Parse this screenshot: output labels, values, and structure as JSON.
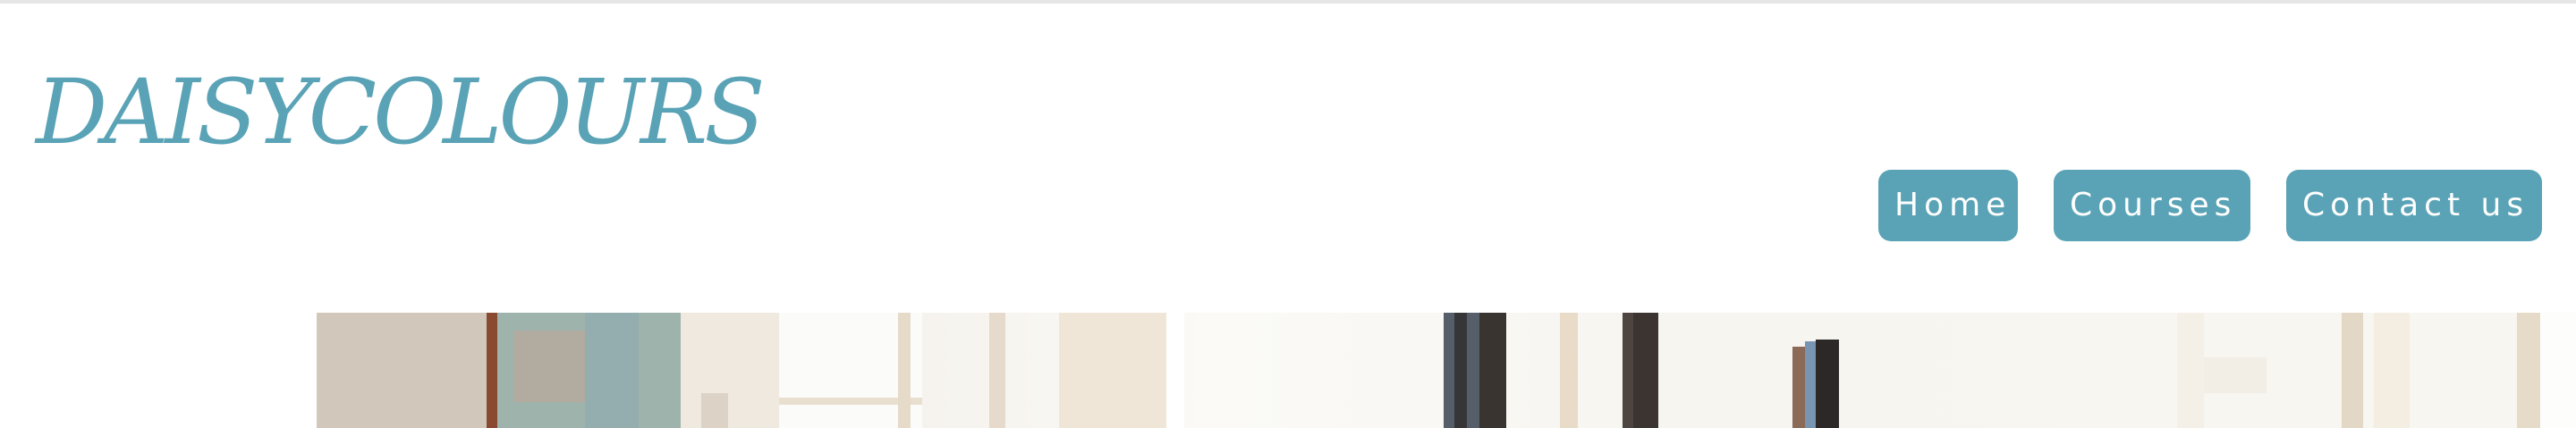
{
  "header": {
    "logo_text": "DAISYCOLOURS"
  },
  "nav": {
    "items": [
      {
        "label": "Home"
      },
      {
        "label": "Courses"
      },
      {
        "label": "Contact us"
      }
    ]
  },
  "colors": {
    "accent": "#5aa3b6",
    "button_text": "#ffffff",
    "background": "#ffffff"
  }
}
